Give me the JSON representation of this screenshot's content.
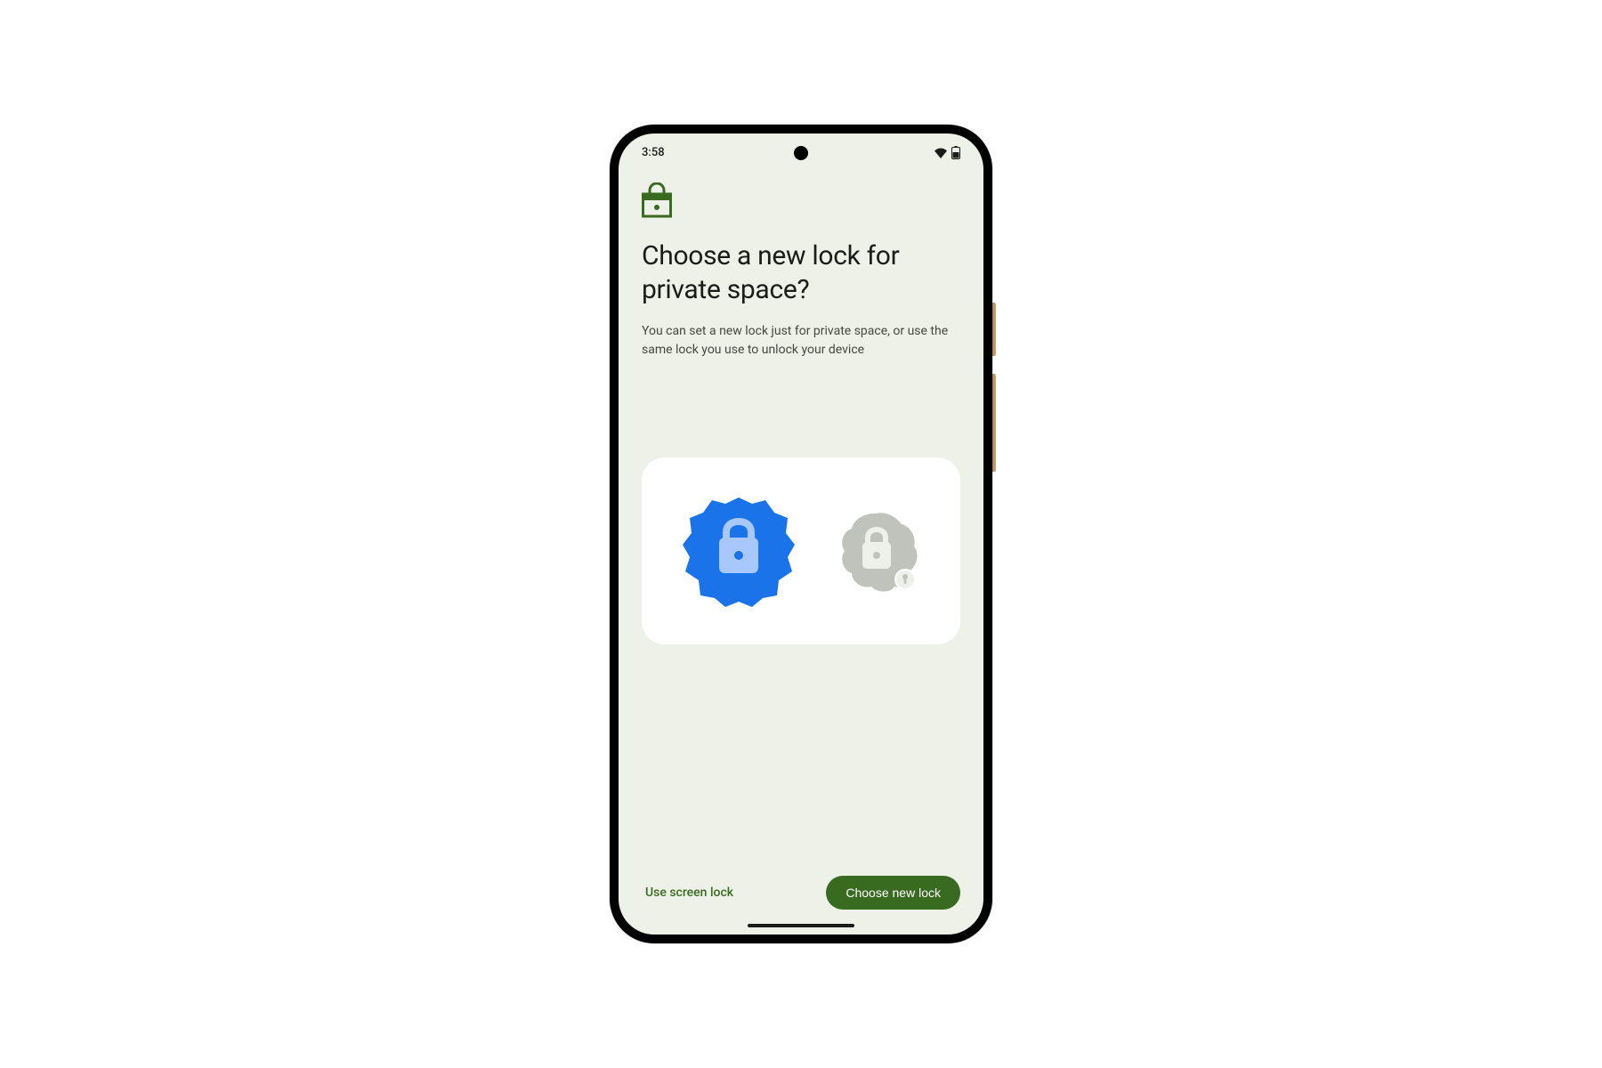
{
  "status": {
    "time": "3:58"
  },
  "header": {
    "title": "Choose a new lock for private space?",
    "subtitle": "You can set a new lock just for private space, or use the same lock you use to unlock your device"
  },
  "footer": {
    "secondary_label": "Use screen lock",
    "primary_label": "Choose new lock"
  }
}
